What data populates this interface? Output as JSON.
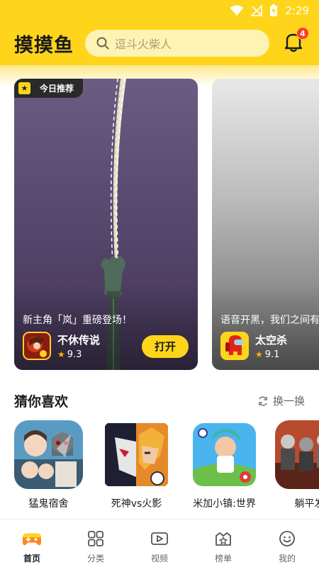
{
  "status_bar": {
    "time": "2:29"
  },
  "header": {
    "logo": "摸摸鱼",
    "search_placeholder": "逗斗火柴人",
    "notification_count": "4"
  },
  "featured": [
    {
      "tag": "今日推荐",
      "caption": "新主角「岚」重磅登场！",
      "game_name": "不休传说",
      "rating": "9.3",
      "action": "打开"
    },
    {
      "caption": "语音开黑，我们之间有",
      "game_name": "太空杀",
      "rating": "9.1"
    }
  ],
  "guess": {
    "title": "猜你喜欢",
    "refresh_label": "换一换",
    "games": [
      {
        "name": "猛鬼宿舍",
        "icon": "ghost-dorm-icon"
      },
      {
        "name": "死神vs火影",
        "icon": "bleach-naruto-icon"
      },
      {
        "name": "米加小镇:世界",
        "icon": "toca-world-icon"
      },
      {
        "name": "躺平发",
        "icon": "lying-flat-icon"
      }
    ]
  },
  "nav": [
    {
      "label": "首页",
      "icon": "gamepad-icon",
      "active": true
    },
    {
      "label": "分类",
      "icon": "grid-icon"
    },
    {
      "label": "视频",
      "icon": "video-icon"
    },
    {
      "label": "榜单",
      "icon": "rank-icon"
    },
    {
      "label": "我的",
      "icon": "profile-icon"
    }
  ],
  "colors": {
    "accent": "#ffd51c",
    "badge": "#ff3b30",
    "star": "#ffb400"
  }
}
